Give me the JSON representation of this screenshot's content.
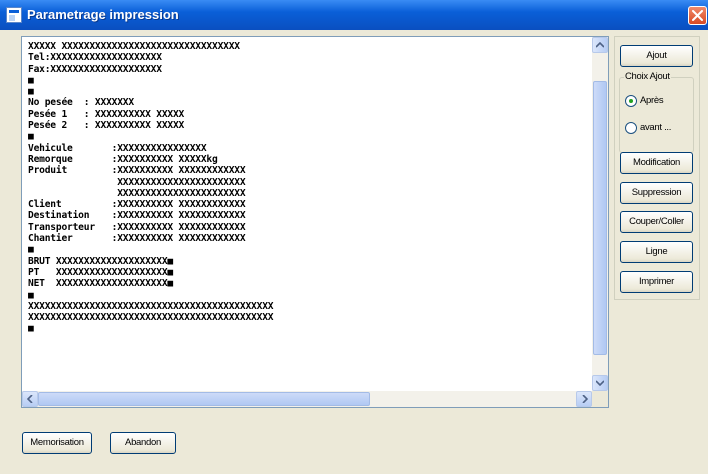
{
  "window": {
    "title": "Parametrage impression"
  },
  "editor": {
    "lines": [
      "XXXXX XXXXXXXXXXXXXXXXXXXXXXXXXXXXXXXX",
      "Tel:XXXXXXXXXXXXXXXXXXXX",
      "Fax:XXXXXXXXXXXXXXXXXXXX",
      "■",
      "■",
      "No pesée  : XXXXXXX",
      "Pesée 1   : XXXXXXXXXX XXXXX",
      "Pesée 2   : XXXXXXXXXX XXXXX",
      "■",
      "Vehicule       :XXXXXXXXXXXXXXXX",
      "Remorque       :XXXXXXXXXX XXXXXkg",
      "Produit        :XXXXXXXXXX XXXXXXXXXXXX",
      "                XXXXXXXXXXXXXXXXXXXXXXX",
      "                XXXXXXXXXXXXXXXXXXXXXXX",
      "Client         :XXXXXXXXXX XXXXXXXXXXXX",
      "Destination    :XXXXXXXXXX XXXXXXXXXXXX",
      "Transporteur   :XXXXXXXXXX XXXXXXXXXXXX",
      "Chantier       :XXXXXXXXXX XXXXXXXXXXXX",
      "■",
      "BRUT XXXXXXXXXXXXXXXXXXXX■",
      "PT   XXXXXXXXXXXXXXXXXXXX■",
      "NET  XXXXXXXXXXXXXXXXXXXX■",
      "■",
      "XXXXXXXXXXXXXXXXXXXXXXXXXXXXXXXXXXXXXXXXXXXX",
      "XXXXXXXXXXXXXXXXXXXXXXXXXXXXXXXXXXXXXXXXXXXX",
      "■"
    ]
  },
  "side": {
    "ajout_label": "Ajout",
    "group_label": "Choix Ajout",
    "radio_apres": "Après",
    "radio_avant": "avant ...",
    "selected_radio": "apres",
    "modification_label": "Modification",
    "suppression_label": "Suppression",
    "couper_coller_label": "Couper/Coller",
    "ligne_label": "Ligne",
    "imprimer_label": "Imprimer"
  },
  "footer": {
    "memorisation_label": "Memorisation",
    "abandon_label": "Abandon"
  },
  "icons": {
    "app": "printer-settings-icon",
    "close": "close-icon",
    "up": "arrow-up-icon",
    "down": "arrow-down-icon",
    "left": "arrow-left-icon",
    "right": "arrow-right-icon"
  },
  "colors": {
    "titlebar": "#0a5fd8",
    "close": "#d84a24",
    "radio_selected": "#21a121"
  }
}
